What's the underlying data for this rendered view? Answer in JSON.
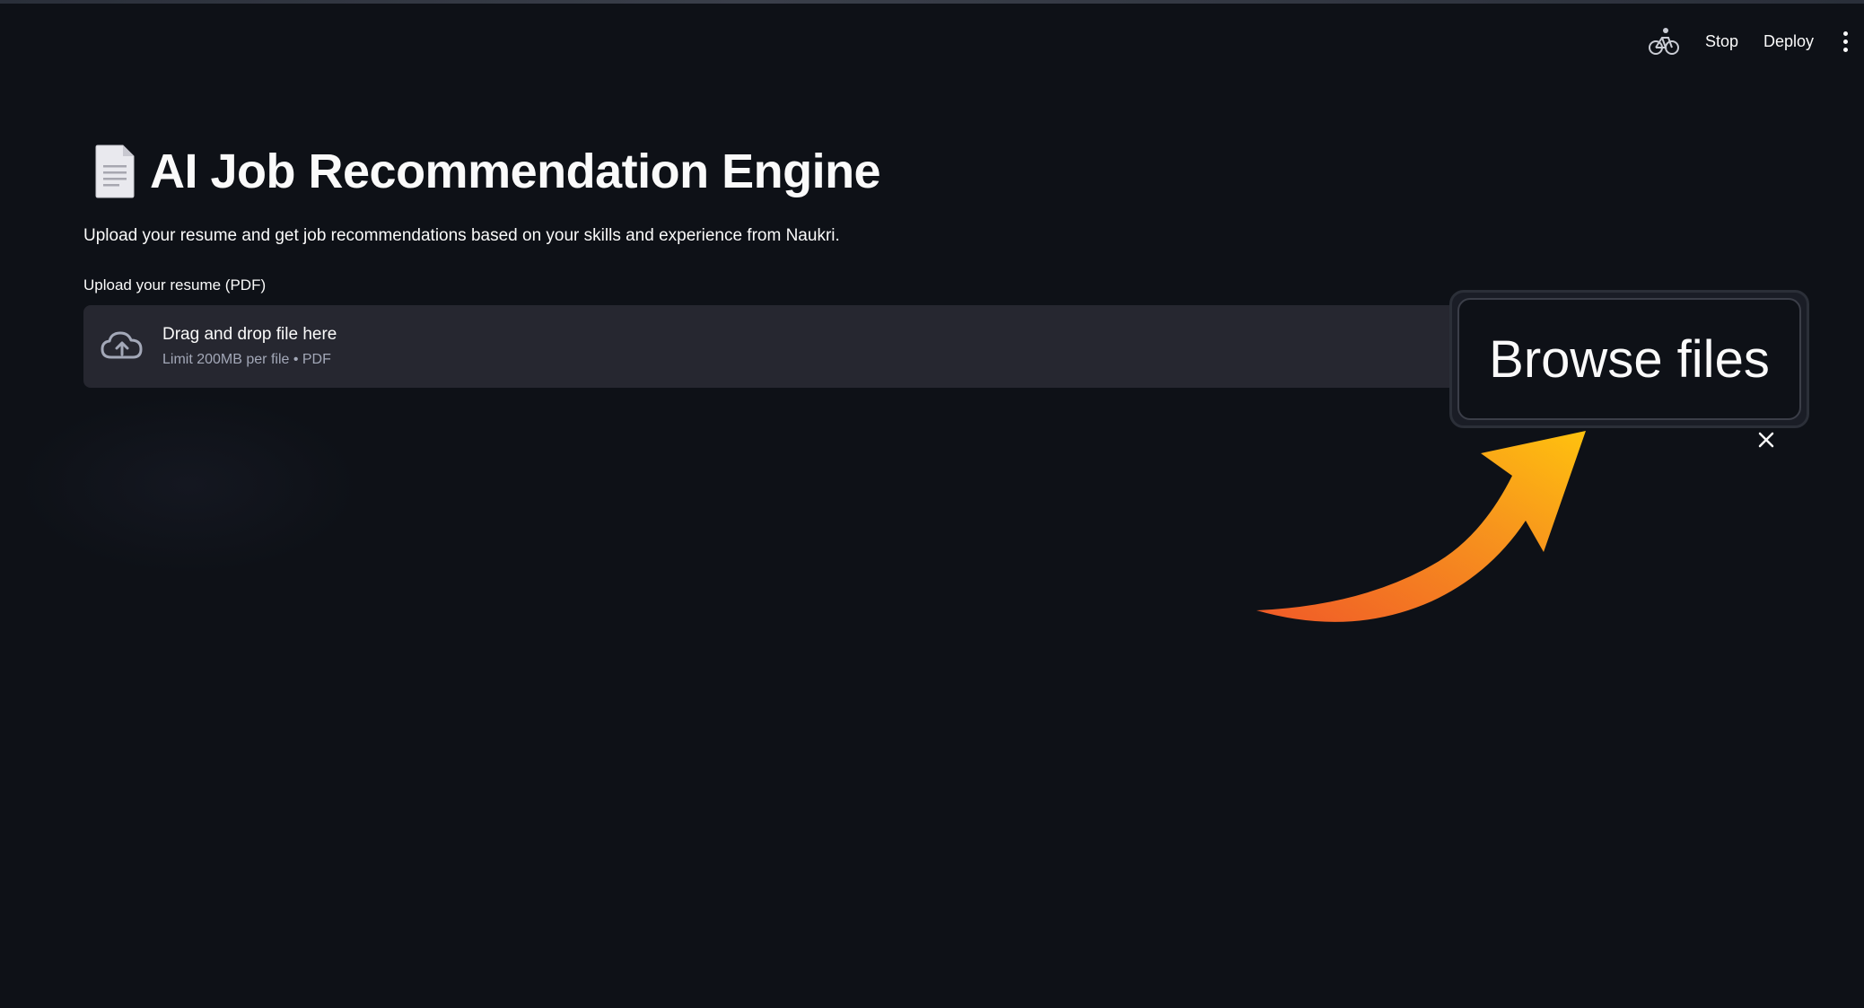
{
  "toolbar": {
    "running_icon": "bicycle-running-icon",
    "stop_label": "Stop",
    "deploy_label": "Deploy",
    "menu_icon": "kebab-menu-icon"
  },
  "main": {
    "title_icon": "document-icon",
    "title": "AI Job Recommendation Engine",
    "subtitle": "Upload your resume and get job recommendations based on your skills and experience from Naukri.",
    "uploader": {
      "label": "Upload your resume (PDF)",
      "dropzone_icon": "cloud-upload-icon",
      "dropzone_title": "Drag and drop file here",
      "dropzone_subtitle": "Limit 200MB per file • PDF",
      "browse_label": "Browse files",
      "close_icon": "close-icon"
    }
  },
  "colors": {
    "background": "#0e1117",
    "dropzone": "#262730",
    "text": "#fafafa",
    "muted_text": "#a3a8b8",
    "arrow_start": "#f05a28",
    "arrow_end": "#ffc20e"
  }
}
